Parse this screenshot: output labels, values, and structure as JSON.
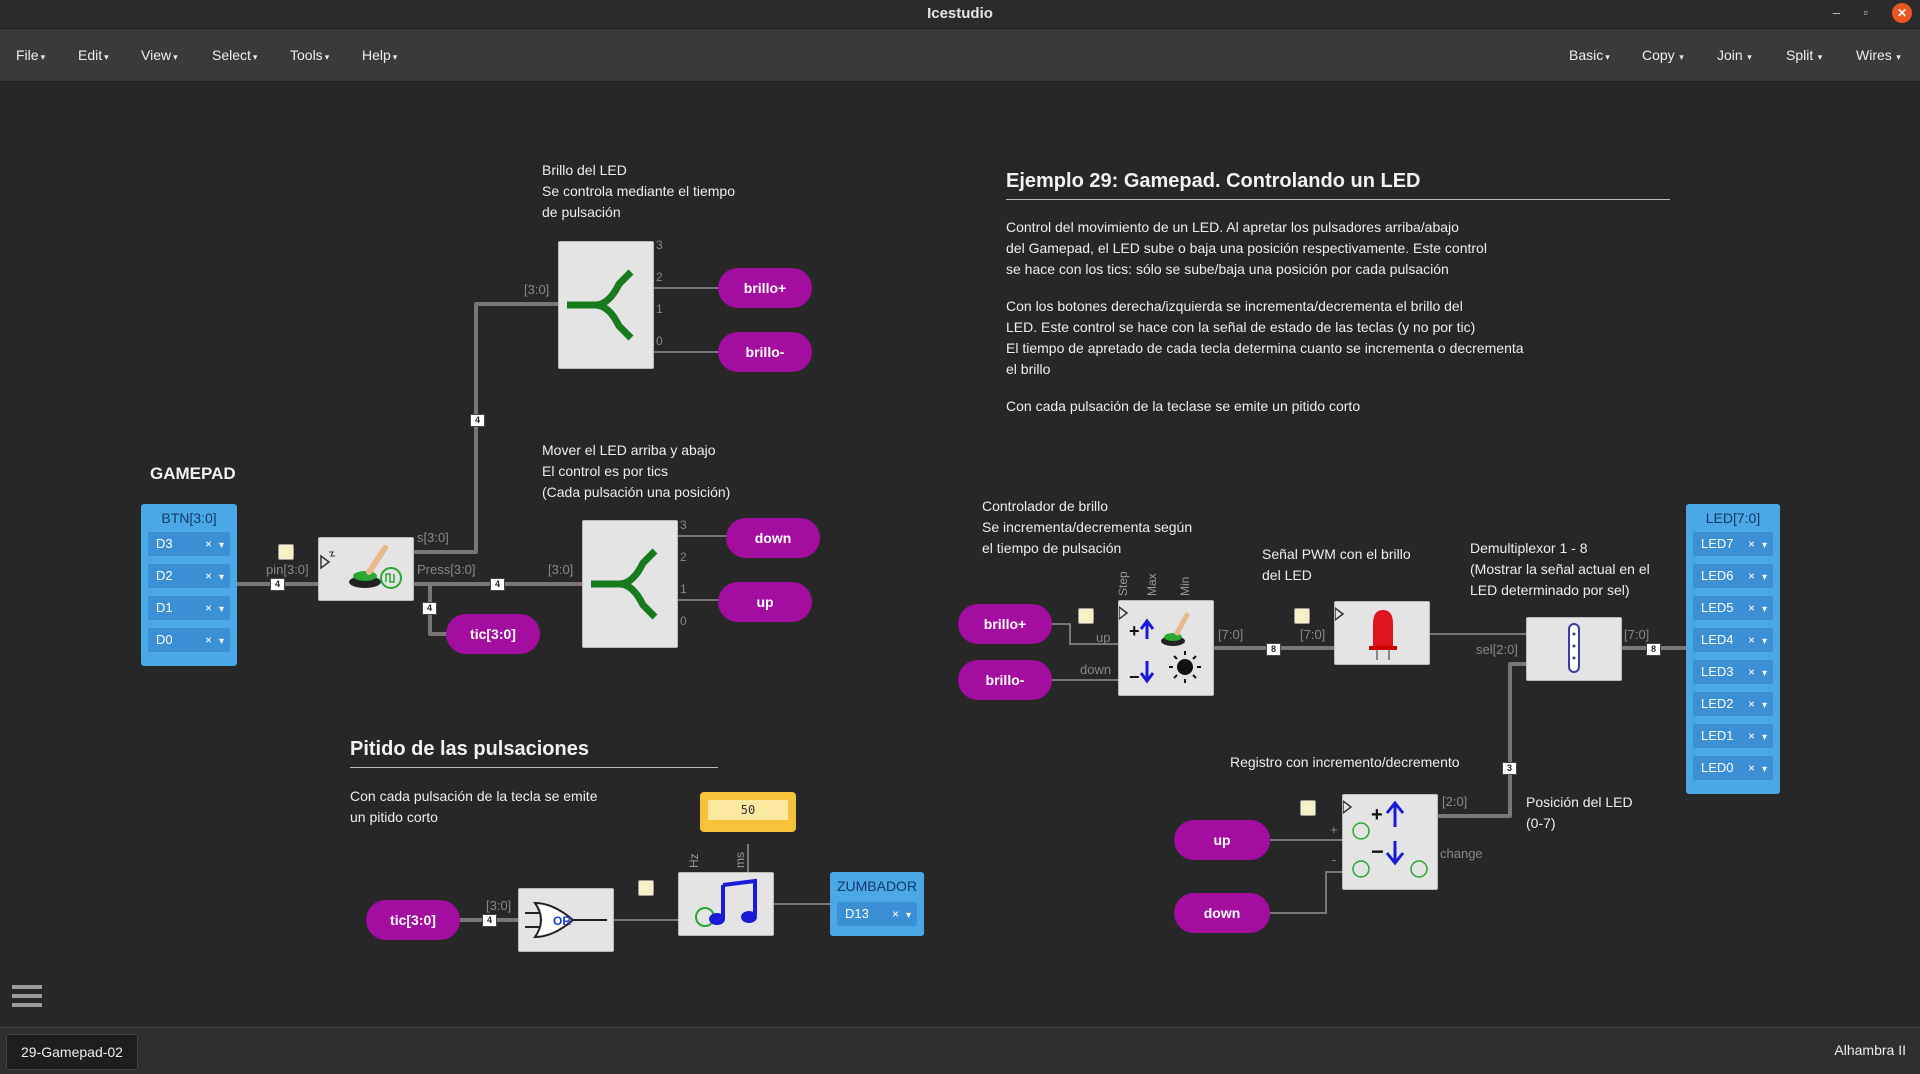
{
  "window": {
    "title": "Icestudio",
    "minimize": "–",
    "maximize": "▫",
    "close": "✕"
  },
  "menu": {
    "left": [
      {
        "label": "File"
      },
      {
        "label": "Edit"
      },
      {
        "label": "View"
      },
      {
        "label": "Select"
      },
      {
        "label": "Tools"
      },
      {
        "label": "Help"
      }
    ],
    "right": [
      {
        "label": "Basic"
      },
      {
        "label": "Copy"
      },
      {
        "label": "Join"
      },
      {
        "label": "Split"
      },
      {
        "label": "Wires"
      }
    ]
  },
  "notes": {
    "brillo_led": "Brillo del LED\nSe controla mediante el tiempo\nde pulsación",
    "mover_led": "Mover el LED arriba y abajo\nEl control es por tics\n(Cada pulsación una posición)",
    "pitido_body": "Con cada pulsación de la tecla se emite\nun pitido corto",
    "controlador": "Controlador de brillo\nSe incrementa/decrementa según\nel tiempo de pulsación",
    "pwm": "Señal PWM con el brillo\ndel LED",
    "demux": "Demultiplexor 1 - 8\n(Mostrar la señal actual en el\nLED determinado por sel)",
    "registro": "Registro con incremento/decremento",
    "posicion": "Posición del LED\n(0-7)",
    "ejemplo_p1": "Control del movimiento de un LED. Al apretar los pulsadores arriba/abajo\ndel Gamepad, el LED sube o baja una posición respectivamente. Este control\nse hace con los tics: sólo se sube/baja una posición por cada pulsación",
    "ejemplo_p2": "Con los botones derecha/izquierda se incrementa/decrementa el brillo del\nLED. Este control se hace con la señal de estado de las teclas (y no por tic)\nEl tiempo de apretado de cada tecla determina cuanto se incrementa o decrementa\nel brillo",
    "ejemplo_p3": "Con cada pulsación de la teclase se emite un pitido corto"
  },
  "headings": {
    "ejemplo": "Ejemplo 29: Gamepad. Controlando un LED",
    "pitido": "Pitido de las pulsaciones",
    "gamepad": "GAMEPAD"
  },
  "gamepad_input": {
    "name": "BTN[3:0]",
    "pins": [
      {
        "label": "D3"
      },
      {
        "label": "D2"
      },
      {
        "label": "D1"
      },
      {
        "label": "D0"
      }
    ]
  },
  "led_output": {
    "name": "LED[7:0]",
    "pins": [
      {
        "label": "LED7"
      },
      {
        "label": "LED6"
      },
      {
        "label": "LED5"
      },
      {
        "label": "LED4"
      },
      {
        "label": "LED3"
      },
      {
        "label": "LED2"
      },
      {
        "label": "LED1"
      },
      {
        "label": "LED0"
      }
    ]
  },
  "zumbador": {
    "name": "ZUMBADOR",
    "pin": "D13"
  },
  "constant_value": "50",
  "ports": {
    "brillo_plus_out": "brillo+",
    "brillo_minus_out": "brillo-",
    "down_out": "down",
    "up_out": "up",
    "tic_out": "tic[3:0]",
    "brillo_plus_in": "brillo+",
    "brillo_minus_in": "brillo-",
    "tic_in": "tic[3:0]",
    "up_in": "up",
    "down_in": "down"
  },
  "wire_labels": {
    "pin": "pin[3:0]",
    "s": "s[3:0]",
    "press": "Press[3:0]",
    "split1_in": "[3:0]",
    "split2_in": "[3:0]",
    "or_in": "[3:0]",
    "up": "up",
    "down": "down",
    "step": "Step",
    "max": "Max",
    "min": "Min",
    "ctrl_out": "[7:0]",
    "pwm_in": "[7:0]",
    "sel": "sel[2:0]",
    "demux_out": "[7:0]",
    "reg_out": "[2:0]",
    "plus": "+",
    "minus": "-",
    "change": "change",
    "hz": "Hz",
    "ms": "ms",
    "or_label": "OR"
  },
  "split_pins": {
    "s1": [
      "3",
      "2",
      "1",
      "0"
    ],
    "s2": [
      "3",
      "2",
      "1",
      "0"
    ]
  },
  "bus_widths": {
    "b4a": "4",
    "b4b": "4",
    "b4c": "4",
    "b4d": "4",
    "b8a": "8",
    "b8b": "8",
    "b3": "3"
  },
  "tab": {
    "filename": "29-Gamepad-02"
  },
  "board": "Alhambra II",
  "colors": {
    "port": "#a40ea0",
    "io": "#4aa8e6",
    "const": "#f6c23a",
    "accent_close": "#e95420"
  }
}
